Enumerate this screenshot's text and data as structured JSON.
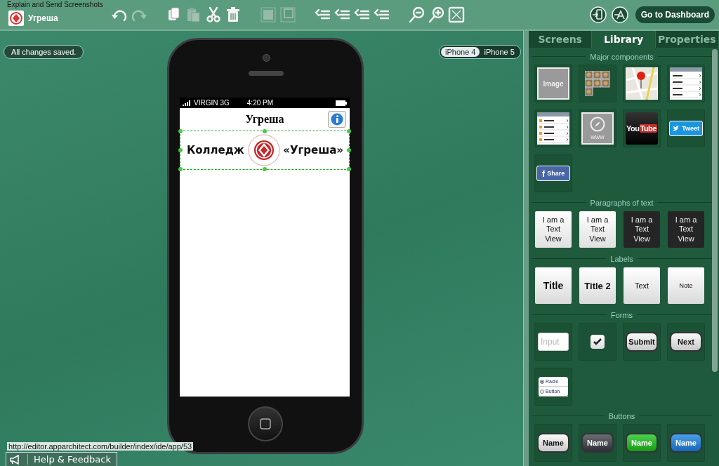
{
  "app": {
    "overlay_title": "Explain and Send Screenshots",
    "project_name": "Угреша"
  },
  "toolbar": {
    "icons": [
      {
        "kind": "undo",
        "disabled": false
      },
      {
        "kind": "redo",
        "disabled": true
      },
      {
        "kind": "copy",
        "disabled": false
      },
      {
        "kind": "paste",
        "disabled": true
      },
      {
        "kind": "cut",
        "disabled": false
      },
      {
        "kind": "delete",
        "disabled": false
      },
      {
        "kind": "front",
        "disabled": true
      },
      {
        "kind": "back",
        "disabled": true
      },
      {
        "kind": "align",
        "disabled": false
      },
      {
        "kind": "align",
        "disabled": false
      },
      {
        "kind": "align",
        "disabled": false
      },
      {
        "kind": "align",
        "disabled": false
      },
      {
        "kind": "zoom-out",
        "disabled": false
      },
      {
        "kind": "zoom-in",
        "disabled": false
      },
      {
        "kind": "fit",
        "disabled": false
      }
    ],
    "actions": [
      {
        "kind": "device"
      },
      {
        "kind": "publish"
      }
    ],
    "dashboard_button": "Go to Dashboard"
  },
  "canvas": {
    "save_status": "All changes saved.",
    "devices": [
      {
        "label": "iPhone 4",
        "selected": true
      },
      {
        "label": "iPhone 5",
        "selected": false
      }
    ],
    "phone": {
      "status_bar": {
        "carrier": "VIRGIN",
        "network": "3G",
        "time": "4:20 PM"
      },
      "nav_title": "Угреша",
      "banner": {
        "left_text": "Колледж",
        "right_text": "«Угреша»",
        "selected": true
      }
    }
  },
  "panel": {
    "tabs": [
      {
        "label": "Screens",
        "selected": false
      },
      {
        "label": "Library",
        "selected": true
      },
      {
        "label": "Properties",
        "selected": false
      }
    ],
    "sections": [
      {
        "title": "Major components",
        "framed": true,
        "items": [
          {
            "kind": "image",
            "label": "Image"
          },
          {
            "kind": "gallery"
          },
          {
            "kind": "map"
          },
          {
            "kind": "table"
          },
          {
            "kind": "rss"
          },
          {
            "kind": "web",
            "label": "www"
          },
          {
            "kind": "youtube",
            "label": "You",
            "label_2": "Tube"
          },
          {
            "kind": "tweet",
            "label": "Tweet"
          },
          {
            "kind": "share",
            "icon_text": "f",
            "label": "Share"
          }
        ]
      },
      {
        "title": "Paragraphs of text",
        "framed": false,
        "items": [
          {
            "kind": "textview-light",
            "label": "I am a Text View"
          },
          {
            "kind": "textview-light",
            "label": "I am a Text View"
          },
          {
            "kind": "textview-dark",
            "label": "I am a Text View"
          },
          {
            "kind": "textview-dark",
            "label": "I am a Text View"
          }
        ]
      },
      {
        "title": "Labels",
        "framed": false,
        "items": [
          {
            "kind": "title",
            "label": "Title"
          },
          {
            "kind": "title2",
            "label": "Title 2"
          },
          {
            "kind": "text",
            "label": "Text"
          },
          {
            "kind": "note",
            "label": "Note"
          }
        ]
      },
      {
        "title": "Forms",
        "framed": true,
        "items": [
          {
            "kind": "input",
            "placeholder": "Input"
          },
          {
            "kind": "checkbox",
            "checked": true
          },
          {
            "kind": "button-light",
            "label": "Submit"
          },
          {
            "kind": "button-light",
            "label": "Next"
          },
          {
            "kind": "radio",
            "label": "Radio",
            "label_2": "Button"
          }
        ]
      },
      {
        "title": "Buttons",
        "framed": true,
        "items": [
          {
            "kind": "button-light",
            "label": "Name"
          },
          {
            "kind": "button-dark",
            "label": "Name"
          },
          {
            "kind": "button-green",
            "label": "Name"
          },
          {
            "kind": "button-blue",
            "label": "Name"
          }
        ]
      }
    ]
  },
  "footer": {
    "help": "Help & Feedback",
    "url": "http://editor.apparchitect.com/builder/index/ide/app/53"
  }
}
